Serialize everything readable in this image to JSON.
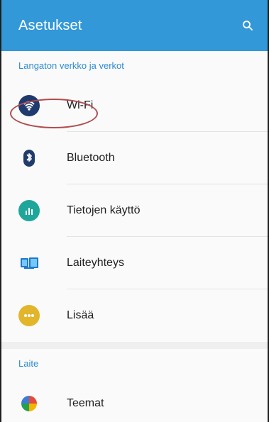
{
  "header": {
    "title": "Asetukset",
    "search_icon": "search-icon"
  },
  "sections": [
    {
      "title": "Langaton verkko ja verkot",
      "items": [
        {
          "label": "Wi-Fi",
          "icon": "wifi-icon",
          "color": "#1e3a6e"
        },
        {
          "label": "Bluetooth",
          "icon": "bluetooth-icon",
          "color": "#213c6a"
        },
        {
          "label": "Tietojen käyttö",
          "icon": "data-usage-icon",
          "color": "#1fa69a"
        },
        {
          "label": "Laiteyhteys",
          "icon": "device-connection-icon",
          "color": "#1f78c8"
        },
        {
          "label": "Lisää",
          "icon": "more-icon",
          "color": "#e2b52b"
        }
      ]
    },
    {
      "title": "Laite",
      "items": [
        {
          "label": "Teemat",
          "icon": "themes-icon",
          "color": "#e34c3c"
        }
      ]
    }
  ],
  "annotation": {
    "type": "ellipse",
    "color": "#b04c50",
    "target": "Wi-Fi"
  }
}
